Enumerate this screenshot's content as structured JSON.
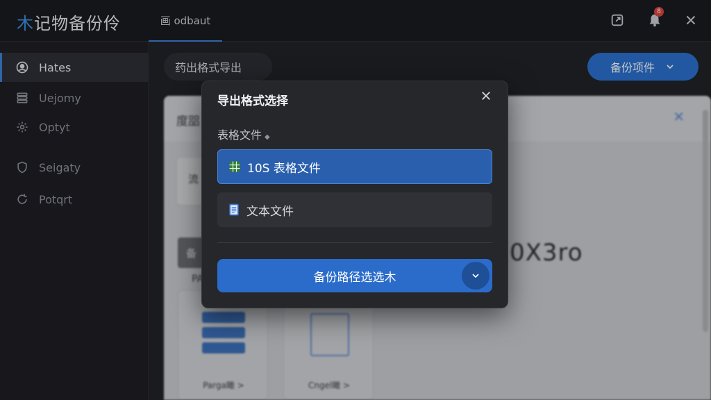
{
  "app": {
    "title_first": "木",
    "title_rest": "记物备份伶",
    "tab": "画 odbaut"
  },
  "header": {
    "notification_count": "8",
    "icons": [
      "external-link-icon",
      "bell-icon",
      "close-icon"
    ]
  },
  "sidebar": {
    "items": [
      {
        "label": "Hates",
        "icon": "user-icon",
        "active": true
      },
      {
        "label": "Uejomy",
        "icon": "database-icon",
        "active": false
      },
      {
        "label": "Optyt",
        "icon": "gear-icon",
        "active": false
      },
      {
        "label": "Seigaty",
        "icon": "shield-icon",
        "active": false
      },
      {
        "label": "Potqrt",
        "icon": "refresh-icon",
        "active": false
      }
    ]
  },
  "toolbar": {
    "export_pill": "药出格式导出",
    "backup_button": "备份项件"
  },
  "background": {
    "panel_title": "度㗊",
    "flow_label": "流",
    "chip_label": "备",
    "pa_label": "PA",
    "big_text": "0X3ro",
    "card1_label": "Parga瞰 >",
    "card2_label": "Cngel瞰 >"
  },
  "modal": {
    "title": "导出格式选择",
    "section_label": "表格文件",
    "options": [
      {
        "label": "10S 表格文件",
        "icon": "spreadsheet-icon",
        "selected": true
      },
      {
        "label": "文本文件",
        "icon": "document-icon",
        "selected": false
      }
    ],
    "path_button": "备份路径选选木"
  },
  "colors": {
    "accent": "#2b6ccb",
    "selected_option": "#2a5fae",
    "badge": "#d9433a",
    "background": "#1e1f23"
  }
}
